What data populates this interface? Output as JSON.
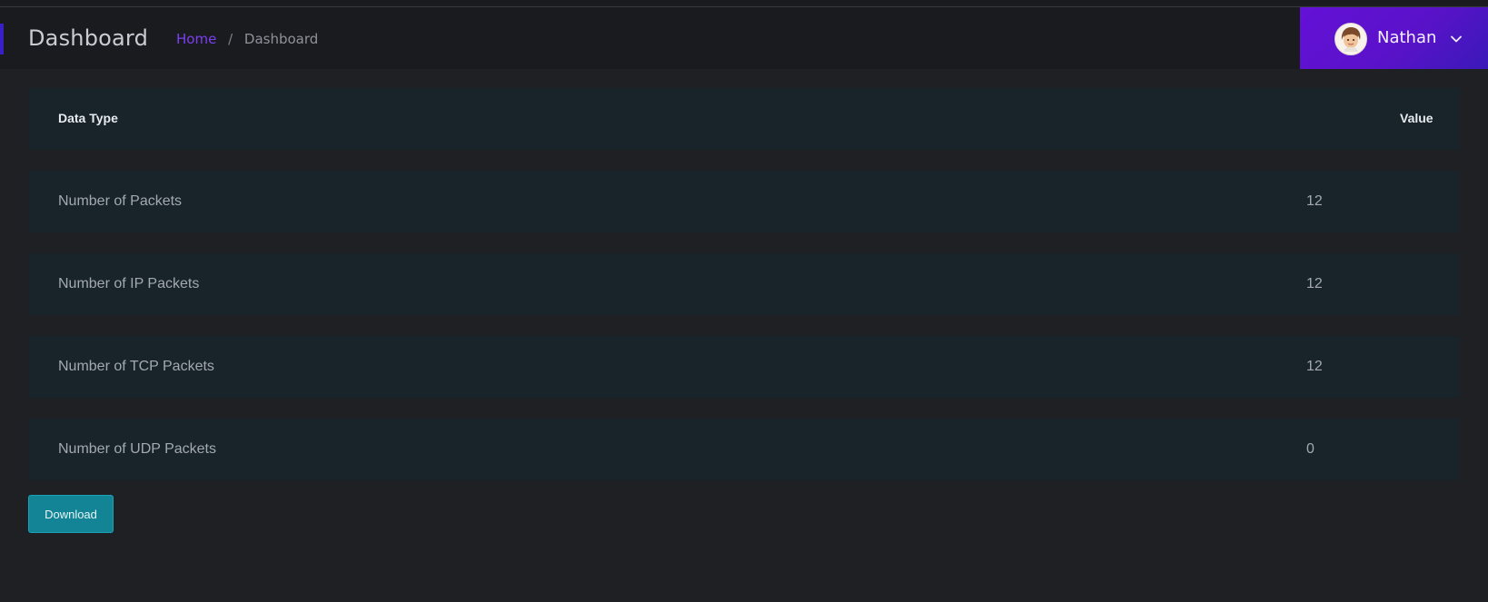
{
  "header": {
    "page_title": "Dashboard",
    "breadcrumb": {
      "home": "Home",
      "separator": "/",
      "current": "Dashboard"
    },
    "user": {
      "name": "Nathan",
      "avatar_icon": "user-avatar-icon",
      "menu_icon": "chevron-down-icon"
    }
  },
  "table": {
    "columns": [
      "Data Type",
      "Value"
    ],
    "rows": [
      {
        "type": "Number of Packets",
        "value": "12"
      },
      {
        "type": "Number of IP Packets",
        "value": "12"
      },
      {
        "type": "Number of TCP Packets",
        "value": "12"
      },
      {
        "type": "Number of UDP Packets",
        "value": "0"
      }
    ]
  },
  "actions": {
    "download_label": "Download"
  },
  "colors": {
    "accent": "#7b3ff2",
    "user_menu": "#6311d6",
    "button": "#138496",
    "background": "#1f2023"
  }
}
